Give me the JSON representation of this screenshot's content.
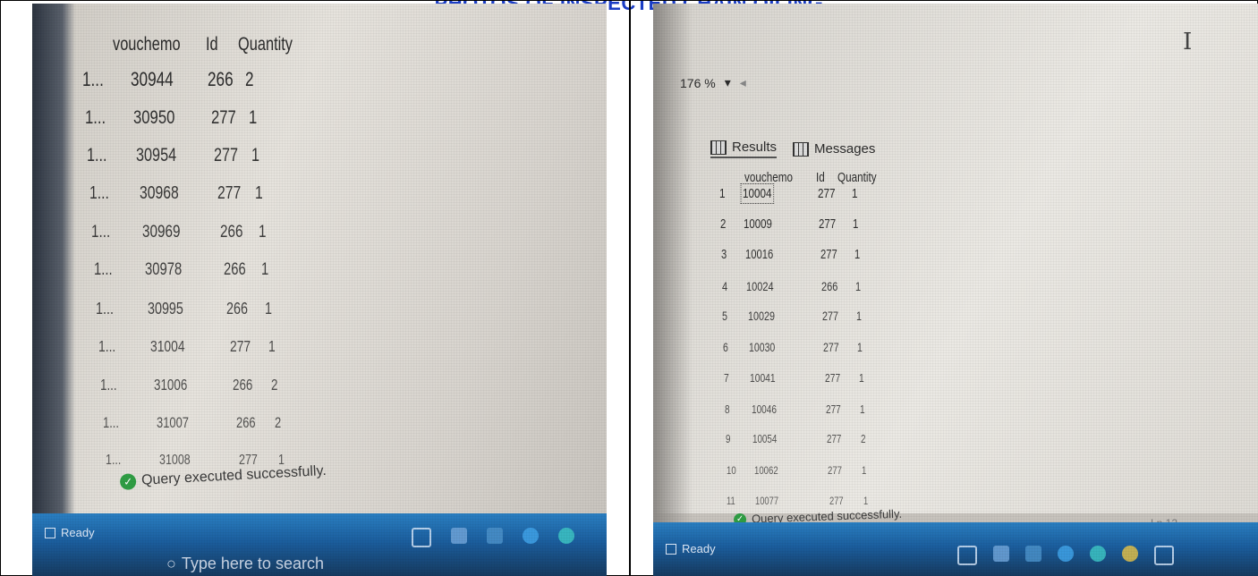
{
  "title": "PHOTOS OF INSPECTED CHAIN OILING",
  "left_photo": {
    "columns": [
      "vouchemo",
      "Id",
      "Quantity"
    ],
    "rows": [
      {
        "rownum": "1...",
        "vouchemo": "30944",
        "id": "266",
        "quantity": "2"
      },
      {
        "rownum": "1...",
        "vouchemo": "30950",
        "id": "277",
        "quantity": "1"
      },
      {
        "rownum": "1...",
        "vouchemo": "30954",
        "id": "277",
        "quantity": "1"
      },
      {
        "rownum": "1...",
        "vouchemo": "30968",
        "id": "277",
        "quantity": "1"
      },
      {
        "rownum": "1...",
        "vouchemo": "30969",
        "id": "266",
        "quantity": "1"
      },
      {
        "rownum": "1...",
        "vouchemo": "30978",
        "id": "266",
        "quantity": "1"
      },
      {
        "rownum": "1...",
        "vouchemo": "30995",
        "id": "266",
        "quantity": "1"
      },
      {
        "rownum": "1...",
        "vouchemo": "31004",
        "id": "277",
        "quantity": "1"
      },
      {
        "rownum": "1...",
        "vouchemo": "31006",
        "id": "266",
        "quantity": "2"
      },
      {
        "rownum": "1...",
        "vouchemo": "31007",
        "id": "266",
        "quantity": "2"
      },
      {
        "rownum": "1...",
        "vouchemo": "31008",
        "id": "277",
        "quantity": "1"
      }
    ],
    "status": "Query executed successfully.",
    "ready": "Ready",
    "search_placeholder": "Type here to search"
  },
  "right_photo": {
    "zoom": "176 %",
    "tabs": [
      {
        "label": "Results",
        "icon": "grid-icon"
      },
      {
        "label": "Messages",
        "icon": "messages-icon"
      }
    ],
    "columns": [
      "vouchemo",
      "Id",
      "Quantity"
    ],
    "rows": [
      {
        "rownum": "1",
        "vouchemo": "10004",
        "id": "277",
        "quantity": "1"
      },
      {
        "rownum": "2",
        "vouchemo": "10009",
        "id": "277",
        "quantity": "1"
      },
      {
        "rownum": "3",
        "vouchemo": "10016",
        "id": "277",
        "quantity": "1"
      },
      {
        "rownum": "4",
        "vouchemo": "10024",
        "id": "266",
        "quantity": "1"
      },
      {
        "rownum": "5",
        "vouchemo": "10029",
        "id": "277",
        "quantity": "1"
      },
      {
        "rownum": "6",
        "vouchemo": "10030",
        "id": "277",
        "quantity": "1"
      },
      {
        "rownum": "7",
        "vouchemo": "10041",
        "id": "277",
        "quantity": "1"
      },
      {
        "rownum": "8",
        "vouchemo": "10046",
        "id": "277",
        "quantity": "1"
      },
      {
        "rownum": "9",
        "vouchemo": "10054",
        "id": "277",
        "quantity": "2"
      },
      {
        "rownum": "10",
        "vouchemo": "10062",
        "id": "277",
        "quantity": "1"
      },
      {
        "rownum": "11",
        "vouchemo": "10077",
        "id": "277",
        "quantity": "1"
      }
    ],
    "status": "Query executed successfully.",
    "ready": "Ready",
    "line_indicator": "Ln 12"
  },
  "colors": {
    "title": "#1a3cc4",
    "status_ok": "#2f9e44",
    "taskbar": "#1b5e9e"
  }
}
